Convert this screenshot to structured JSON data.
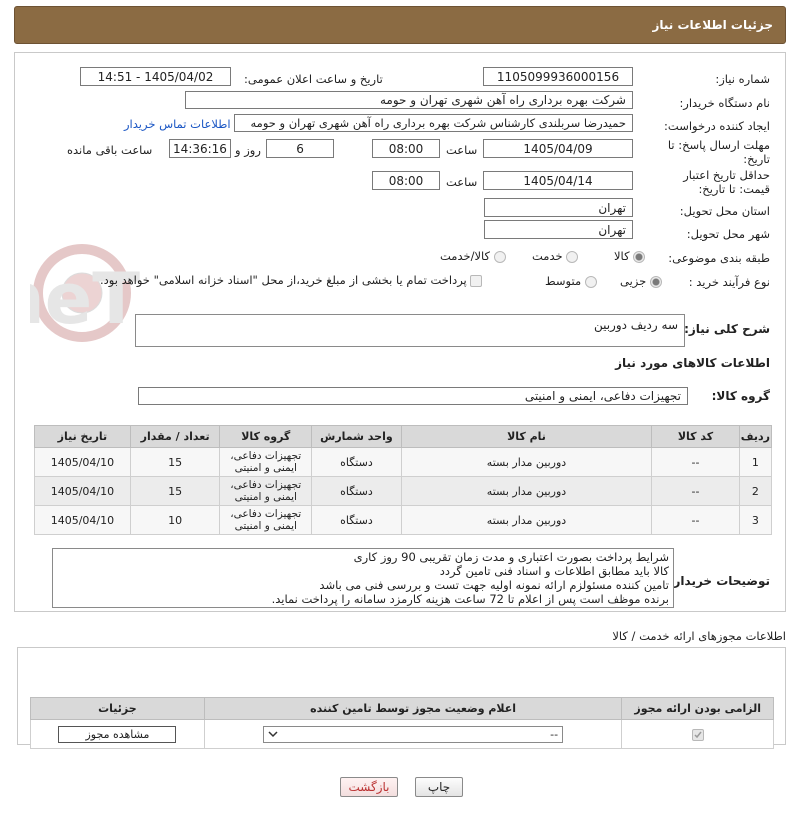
{
  "page": {
    "title": "جزئیات اطلاعات نیاز"
  },
  "form": {
    "need_number_label": "شماره نیاز:",
    "need_number": "1105099936000156",
    "announce_label": "تاریخ و ساعت اعلان عمومی:",
    "announce_value": "1405/04/02 - 14:51",
    "buyer_org_label": "نام دستگاه خریدار:",
    "buyer_org": "شرکت بهره برداری راه آهن شهری تهران و حومه",
    "creator_label": "ایجاد کننده درخواست:",
    "creator": "حمیدرضا سربلندی کارشناس شرکت بهره برداری راه آهن شهری تهران و حومه",
    "contact_link": "اطلاعات تماس خریدار",
    "send_deadline_label": "مهلت ارسال پاسخ: تا تاریخ:",
    "send_date": "1405/04/09",
    "time_label": "ساعت",
    "send_time": "08:00",
    "days": "6",
    "days_label": "روز و",
    "remaining_time": "14:36:16",
    "remaining_label": "ساعت باقی مانده",
    "price_deadline_label": "حداقل تاریخ اعتبار قیمت: تا تاریخ:",
    "price_date": "1405/04/14",
    "price_time": "08:00",
    "province_label": "استان محل تحویل:",
    "province": "تهران",
    "city_label": "شهر محل تحویل:",
    "city": "تهران",
    "category_label": "طبقه بندی موضوعی:",
    "category_options": [
      "کالا",
      "خدمت",
      "کالا/خدمت"
    ],
    "category_selected": "کالا",
    "process_label": "نوع فرآیند خرید :",
    "process_options": [
      "جزیی",
      "متوسط"
    ],
    "process_selected": "جزیی",
    "payment_note": "پرداخت تمام یا بخشی از مبلغ خرید،از محل \"اسناد خزانه اسلامی\" خواهد بود.",
    "description_label": "شرح کلی نیاز:",
    "description": "سه ردیف دوربین",
    "goods_info_title": "اطلاعات کالاهای مورد نیاز",
    "goods_group_label": "گروه کالا:",
    "goods_group": "تجهیزات دفاعی، ایمنی و امنیتی"
  },
  "table": {
    "headers": [
      "ردیف",
      "کد کالا",
      "نام کالا",
      "واحد شمارش",
      "گروه کالا",
      "تعداد / مقدار",
      "تاریخ نیاز"
    ],
    "rows": [
      {
        "row": "1",
        "code": "--",
        "name": "دوربین مدار بسته",
        "unit": "دستگاه",
        "group": "تجهیزات دفاعی، ایمنی و امنیتی",
        "qty": "15",
        "date": "1405/04/10"
      },
      {
        "row": "2",
        "code": "--",
        "name": "دوربین مدار بسته",
        "unit": "دستگاه",
        "group": "تجهیزات دفاعی، ایمنی و امنیتی",
        "qty": "15",
        "date": "1405/04/10"
      },
      {
        "row": "3",
        "code": "--",
        "name": "دوربین مدار بسته",
        "unit": "دستگاه",
        "group": "تجهیزات دفاعی، ایمنی و امنیتی",
        "qty": "10",
        "date": "1405/04/10"
      }
    ]
  },
  "buyer_notes": {
    "label": "توضیحات خریدار:",
    "lines": [
      "شرایط پرداخت بصورت اعتباری و مدت زمان تقریبی 90 روز کاری",
      "کالا باید مطابق اطلاعات و اسناد فنی تامین گردد",
      "تامین کننده مسئولزم ارائه نمونه اولیه جهت تست و بررسی فنی می باشد",
      "برنده موظف است پس از اعلام  تا 72 ساعت هزینه کارمزد سامانه را پرداخت نماید."
    ]
  },
  "permits": {
    "title": "اطلاعات مجوزهای ارائه خدمت / کالا",
    "headers": [
      "الزامی بودن ارائه مجوز",
      "اعلام وضعیت مجوز توسط تامین کننده",
      "جزئیات"
    ],
    "status_value": "--",
    "view_button": "مشاهده مجوز"
  },
  "actions": {
    "print": "چاپ",
    "back": "بازگشت"
  },
  "watermark": "AriaTender.neT"
}
